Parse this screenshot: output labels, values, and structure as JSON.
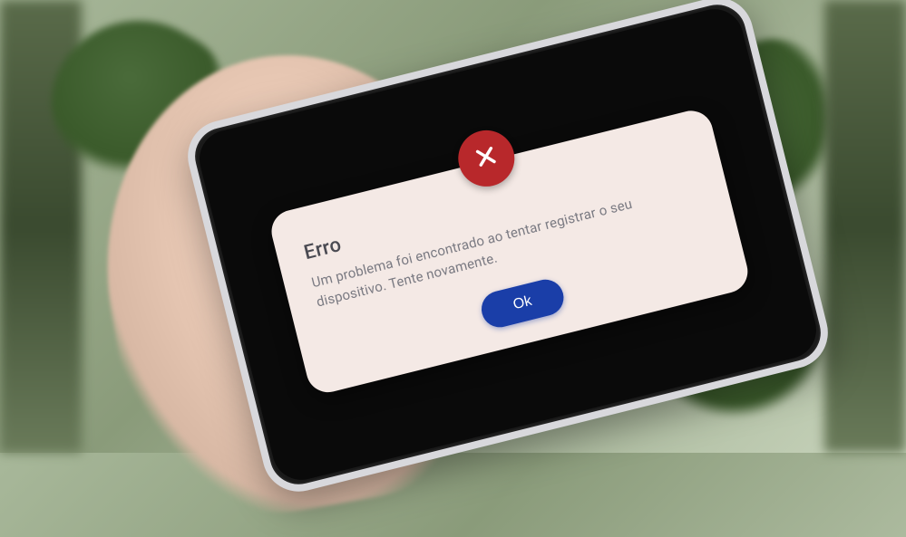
{
  "dialog": {
    "icon": "close-x",
    "title": "Erro",
    "message": "Um problema foi encontrado ao tentar registrar o seu dispositivo. Tente novamente.",
    "ok_label": "Ok"
  },
  "colors": {
    "error_badge": "#b8282b",
    "primary_button": "#1a3ea8",
    "card_bg": "#f4e9e5"
  }
}
